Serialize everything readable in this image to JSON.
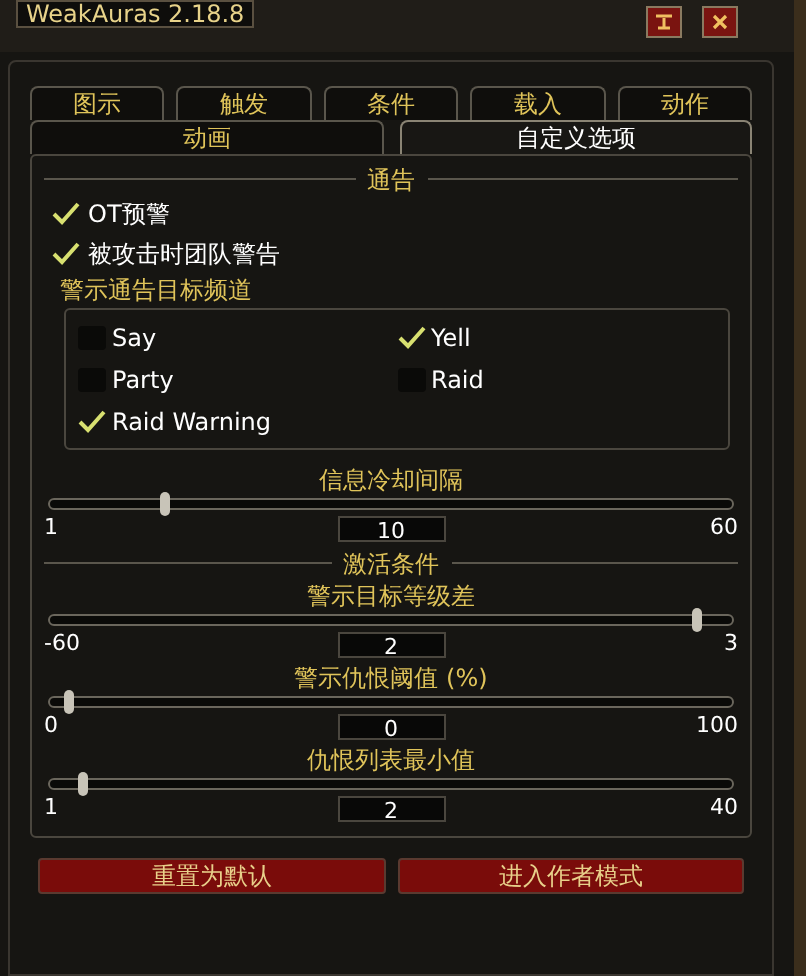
{
  "window": {
    "title": "WeakAuras 2.18.8"
  },
  "tab_rows": [
    [
      {
        "label": "图示",
        "selected": false
      },
      {
        "label": "触发",
        "selected": false
      },
      {
        "label": "条件",
        "selected": false
      },
      {
        "label": "载入",
        "selected": false
      },
      {
        "label": "动作",
        "selected": false
      }
    ],
    [
      {
        "label": "动画",
        "selected": false
      },
      {
        "label": "自定义选项",
        "selected": true
      }
    ]
  ],
  "sections": [
    {
      "header": "通告",
      "items": [
        {
          "kind": "checkbox",
          "label": "OT预警",
          "checked": true
        },
        {
          "kind": "checkbox",
          "label": "被攻击时团队警告",
          "checked": true
        },
        {
          "kind": "group",
          "label": "警示通告目标频道",
          "options": [
            {
              "label": "Say",
              "checked": false
            },
            {
              "label": "Yell",
              "checked": true
            },
            {
              "label": "Party",
              "checked": false
            },
            {
              "label": "Raid",
              "checked": false
            },
            {
              "label": "Raid Warning",
              "checked": true
            }
          ]
        },
        {
          "kind": "slider",
          "label": "信息冷却间隔",
          "min": "1",
          "max": "60",
          "value": "10",
          "level": 0.17
        }
      ]
    },
    {
      "header": "激活条件",
      "items": [
        {
          "kind": "slider",
          "label": "警示目标等级差",
          "min": "-60",
          "max": "3",
          "value": "2",
          "level": 0.95
        },
        {
          "kind": "slider",
          "label": "警示仇恨阈值 (%)",
          "min": "0",
          "max": "100",
          "value": "0",
          "level": 0.03
        },
        {
          "kind": "slider",
          "label": "仇恨列表最小值",
          "min": "1",
          "max": "40",
          "value": "2",
          "level": 0.05
        }
      ]
    }
  ],
  "buttons": [
    "重置为默认",
    "进入作者模式"
  ]
}
